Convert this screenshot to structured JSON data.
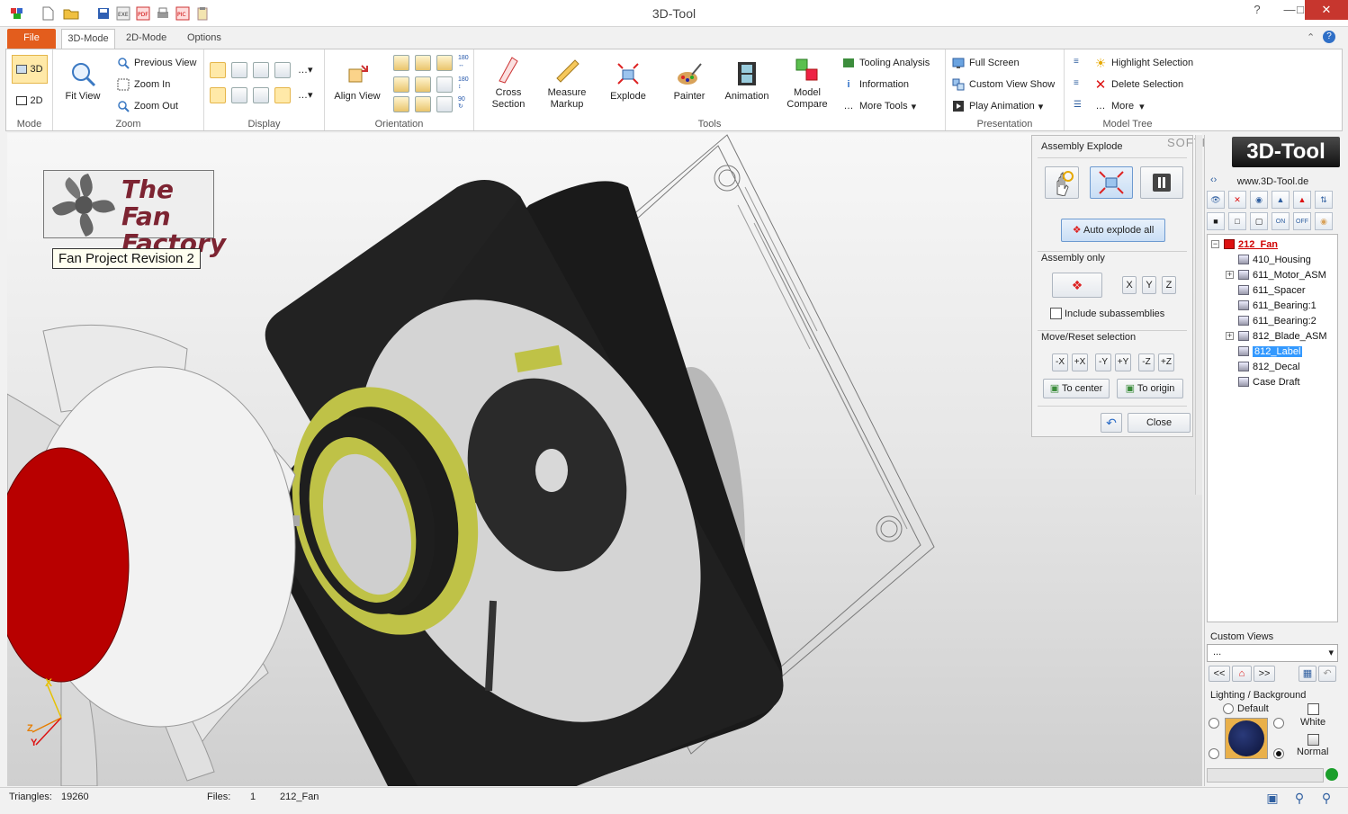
{
  "app": {
    "title": "3D-Tool"
  },
  "tabs": [
    {
      "label": "File"
    },
    {
      "label": "3D-Mode"
    },
    {
      "label": "2D-Mode"
    },
    {
      "label": "Options"
    }
  ],
  "ribbon": {
    "mode": {
      "label": "Mode",
      "btn_3d": "3D",
      "btn_2d": "2D"
    },
    "zoom": {
      "label": "Zoom",
      "fit_view": "Fit View",
      "previous_view": "Previous View",
      "zoom_in": "Zoom In",
      "zoom_out": "Zoom Out"
    },
    "display": {
      "label": "Display"
    },
    "orientation": {
      "label": "Orientation",
      "align_view": "Align View"
    },
    "tools": {
      "label": "Tools",
      "cross_section": "Cross\nSection",
      "measure_markup": "Measure\nMarkup",
      "explode": "Explode",
      "painter": "Painter",
      "animation": "Animation",
      "model_compare": "Model\nCompare",
      "tooling_analysis": "Tooling Analysis",
      "information": "Information",
      "more_tools": "More Tools"
    },
    "presentation": {
      "label": "Presentation",
      "full_screen": "Full Screen",
      "custom_view_show": "Custom View Show",
      "play_animation": "Play Animation"
    },
    "model_tree": {
      "label": "Model Tree",
      "highlight_selection": "Highlight Selection",
      "delete_selection": "Delete Selection",
      "more": "More"
    }
  },
  "viewport": {
    "logo_line1": "The Fan",
    "logo_line2": "Factory",
    "project_label": "Fan Project Revision 2",
    "axis_x": "X",
    "axis_y": "Y",
    "axis_z": "Z",
    "watermark": "SOFTPEDIA"
  },
  "explode_panel": {
    "title": "Assembly Explode",
    "auto_explode_all": "Auto explode all",
    "assembly_only": "Assembly only",
    "x": "X",
    "y": "Y",
    "z": "Z",
    "include_subassemblies": "Include subassemblies",
    "include_subassemblies_checked": false,
    "move_reset": "Move/Reset selection",
    "axes": [
      "-X",
      "+X",
      "-Y",
      "+Y",
      "-Z",
      "+Z"
    ],
    "to_center": "To center",
    "to_origin": "To origin",
    "close": "Close"
  },
  "right_panel": {
    "brand": "3D-Tool",
    "url": "www.3D-Tool.de",
    "tool_labels": {
      "on": "ON",
      "off": "OFF"
    },
    "tree": [
      {
        "label": "212_Fan",
        "root": true
      },
      {
        "label": "410_Housing"
      },
      {
        "label": "611_Motor_ASM",
        "expandable": true
      },
      {
        "label": "611_Spacer"
      },
      {
        "label": "611_Bearing:1"
      },
      {
        "label": "611_Bearing:2"
      },
      {
        "label": "812_Blade_ASM",
        "expandable": true
      },
      {
        "label": "812_Label",
        "selected": true
      },
      {
        "label": "812_Decal"
      },
      {
        "label": "Case Draft"
      }
    ],
    "custom_views": {
      "label": "Custom Views",
      "selected": "...",
      "prev": "<<",
      "next": ">>"
    },
    "lighting": {
      "label": "Lighting / Background",
      "default": "Default",
      "white": "White",
      "normal": "Normal"
    }
  },
  "status": {
    "triangles_label": "Triangles:",
    "triangles_value": "19260",
    "files_label": "Files:",
    "files_value": "1",
    "file_name": "212_Fan"
  },
  "colors": {
    "file_tab": "#e35d1d",
    "tree_root": "#d00000",
    "selection": "#3399ff",
    "fan_red": "#b80000",
    "fan_yellow": "#bfc247"
  }
}
